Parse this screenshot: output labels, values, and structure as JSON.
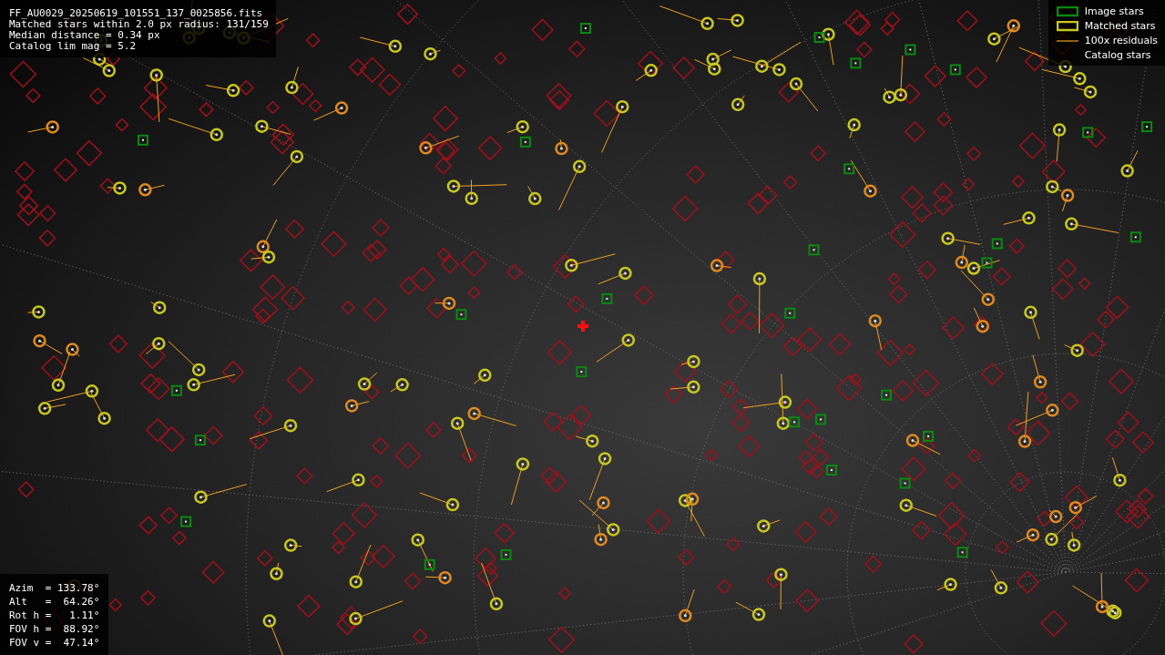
{
  "info_lines": [
    "FF_AU0029_20250619_101551_137_0025856.fits",
    "Matched stars within 2.0 px radius: 131/159",
    "Median distance = 0.34 px",
    "Catalog lim mag = 5.2"
  ],
  "legend": [
    {
      "kind": "image",
      "label": "Image stars"
    },
    {
      "kind": "matched",
      "label": "Matched stars"
    },
    {
      "kind": "residual",
      "label": "100x residuals"
    },
    {
      "kind": "catalog",
      "label": "Catalog stars"
    }
  ],
  "pointing": [
    "Azim  = 133.78°",
    "Alt   =  64.26°",
    "Rot h =   1.11°",
    "FOV h =  88.92°",
    "FOV v =  47.14°"
  ]
}
